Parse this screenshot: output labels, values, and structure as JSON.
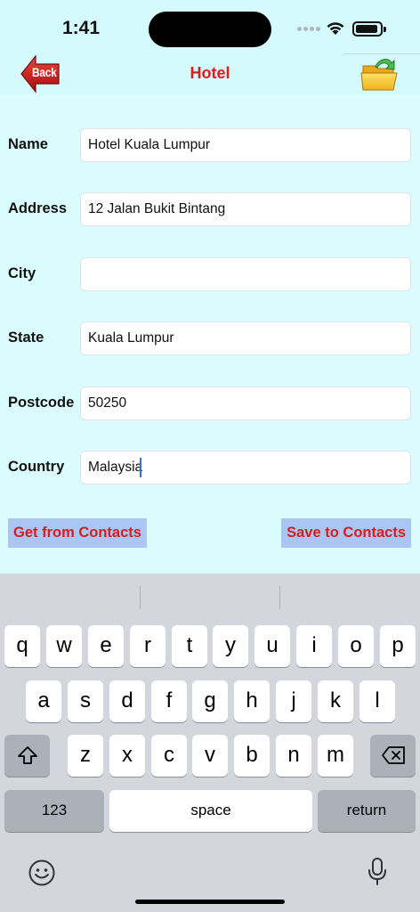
{
  "status_bar": {
    "time": "1:41"
  },
  "nav": {
    "back_label": "Back",
    "title": "Hotel"
  },
  "form": {
    "fields": [
      {
        "label": "Name",
        "value": "Hotel Kuala Lumpur"
      },
      {
        "label": "Address",
        "value": "12 Jalan Bukit Bintang"
      },
      {
        "label": "City",
        "value": ""
      },
      {
        "label": "State",
        "value": "Kuala Lumpur"
      },
      {
        "label": "Postcode",
        "value": "50250"
      },
      {
        "label": "Country",
        "value": "Malaysia"
      }
    ]
  },
  "actions": {
    "get_contacts": "Get from Contacts",
    "save_contacts": "Save to Contacts"
  },
  "keyboard": {
    "row1": [
      "q",
      "w",
      "e",
      "r",
      "t",
      "y",
      "u",
      "i",
      "o",
      "p"
    ],
    "row2": [
      "a",
      "s",
      "d",
      "f",
      "g",
      "h",
      "j",
      "k",
      "l"
    ],
    "row3": [
      "z",
      "x",
      "c",
      "v",
      "b",
      "n",
      "m"
    ],
    "numbers": "123",
    "space": "space",
    "return": "return"
  },
  "colors": {
    "background": "#dbfcfd",
    "title": "#e21a1a",
    "button_bg": "#aac6f3",
    "button_text": "#d81d1d"
  }
}
